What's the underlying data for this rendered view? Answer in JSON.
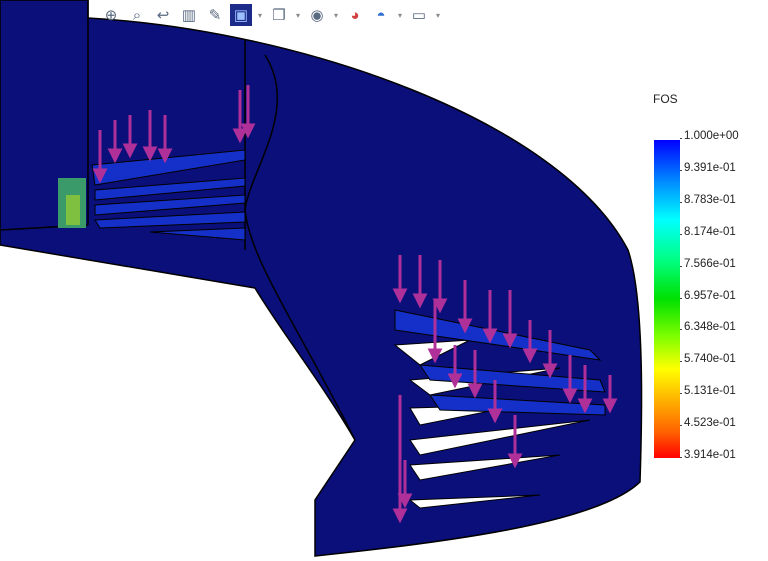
{
  "toolbar": {
    "icons": [
      "zoom-to-fit-icon",
      "zoom-to-area-icon",
      "previous-view-icon",
      "section-view-icon",
      "dynamic-annotation-icon",
      "view-orientation-icon",
      "display-style-icon",
      "hide-show-items-icon",
      "edit-appearance-icon",
      "apply-scene-icon",
      "view-settings-icon"
    ]
  },
  "legend": {
    "title": "FOS",
    "ticks": [
      "1.000e+00",
      "9.391e-01",
      "8.783e-01",
      "8.174e-01",
      "7.566e-01",
      "6.957e-01",
      "6.348e-01",
      "5.740e-01",
      "5.131e-01",
      "4.523e-01",
      "3.914e-01"
    ],
    "colors": {
      "max": "#0000ff",
      "min": "#ff0000"
    }
  },
  "model": {
    "fill": "#0a0f7a",
    "load_arrow_color": "#b0309a"
  }
}
